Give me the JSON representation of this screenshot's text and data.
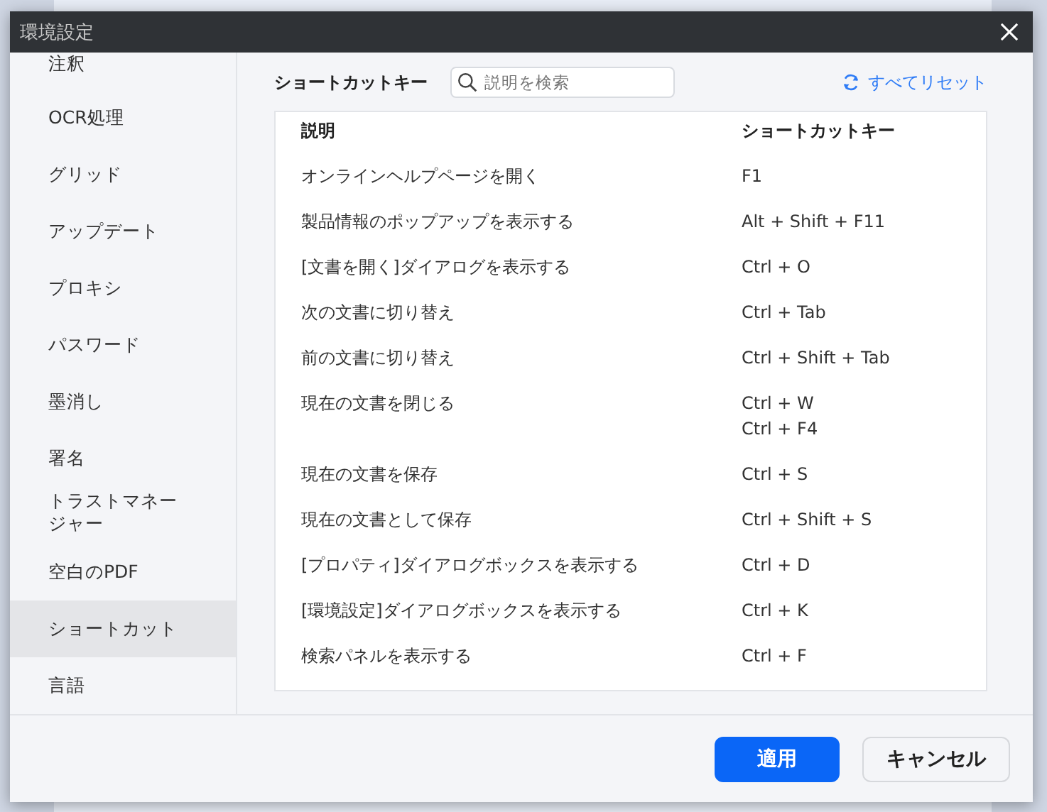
{
  "window": {
    "title": "環境設定"
  },
  "sidebar": {
    "items": [
      {
        "label": "注釈",
        "selected": false
      },
      {
        "label": "OCR処理",
        "selected": false
      },
      {
        "label": "グリッド",
        "selected": false
      },
      {
        "label": "アップデート",
        "selected": false
      },
      {
        "label": "プロキシ",
        "selected": false
      },
      {
        "label": "パスワード",
        "selected": false
      },
      {
        "label": "墨消し",
        "selected": false
      },
      {
        "label": "署名",
        "selected": false
      },
      {
        "label": "トラストマネージャー",
        "selected": false
      },
      {
        "label": "空白のPDF",
        "selected": false
      },
      {
        "label": "ショートカット",
        "selected": true
      },
      {
        "label": "言語",
        "selected": false
      }
    ]
  },
  "header": {
    "title": "ショートカットキー",
    "search": {
      "placeholder": "説明を検索"
    },
    "reset": "すべてリセット"
  },
  "table": {
    "columns": [
      "説明",
      "ショートカットキー"
    ],
    "rows": [
      {
        "description": "オンラインヘルプページを開く",
        "keys": [
          "F1"
        ]
      },
      {
        "description": "製品情報のポップアップを表示する",
        "keys": [
          "Alt + Shift + F11"
        ]
      },
      {
        "description": "[文書を開く]ダイアログを表示する",
        "keys": [
          "Ctrl + O"
        ]
      },
      {
        "description": "次の文書に切り替え",
        "keys": [
          "Ctrl + Tab"
        ]
      },
      {
        "description": "前の文書に切り替え",
        "keys": [
          "Ctrl + Shift + Tab"
        ]
      },
      {
        "description": "現在の文書を閉じる",
        "keys": [
          "Ctrl + W",
          "Ctrl + F4"
        ]
      },
      {
        "description": "現在の文書を保存",
        "keys": [
          "Ctrl + S"
        ]
      },
      {
        "description": "現在の文書として保存",
        "keys": [
          "Ctrl + Shift + S"
        ]
      },
      {
        "description": "[プロパティ]ダイアログボックスを表示する",
        "keys": [
          "Ctrl + D"
        ]
      },
      {
        "description": "[環境設定]ダイアログボックスを表示する",
        "keys": [
          "Ctrl + K"
        ]
      },
      {
        "description": "検索パネルを表示する",
        "keys": [
          "Ctrl + F"
        ]
      }
    ]
  },
  "buttons": [
    {
      "label": "適用",
      "kind": "primary"
    },
    {
      "label": "キャンセル",
      "kind": "secondary"
    }
  ]
}
